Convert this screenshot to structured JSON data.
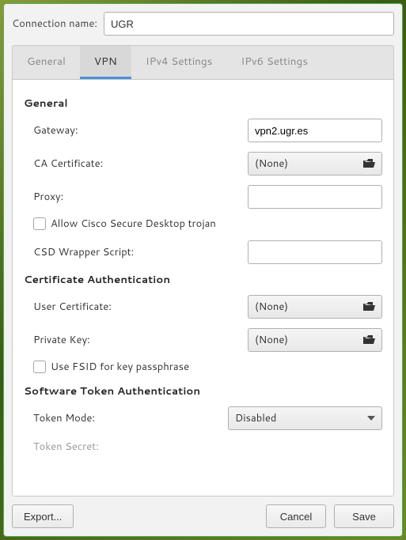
{
  "header": {
    "connection_name_label": "Connection name:",
    "connection_name_value": "UGR"
  },
  "tabs": {
    "general": "General",
    "vpn": "VPN",
    "ipv4": "IPv4 Settings",
    "ipv6": "IPv6 Settings"
  },
  "sections": {
    "general": {
      "title": "General",
      "gateway_label": "Gateway:",
      "gateway_value": "vpn2.ugr.es",
      "ca_cert_label": "CA Certificate:",
      "ca_cert_value": "(None)",
      "proxy_label": "Proxy:",
      "proxy_value": "",
      "allow_cisco_label": "Allow Cisco Secure Desktop trojan",
      "csd_wrapper_label": "CSD Wrapper Script:",
      "csd_wrapper_value": ""
    },
    "cert_auth": {
      "title": "Certificate Authentication",
      "user_cert_label": "User Certificate:",
      "user_cert_value": "(None)",
      "private_key_label": "Private Key:",
      "private_key_value": "(None)",
      "fsid_label": "Use FSID for key passphrase"
    },
    "token_auth": {
      "title": "Software Token Authentication",
      "token_mode_label": "Token Mode:",
      "token_mode_value": "Disabled",
      "token_secret_label": "Token Secret:"
    }
  },
  "footer": {
    "export": "Export...",
    "cancel": "Cancel",
    "save": "Save"
  }
}
